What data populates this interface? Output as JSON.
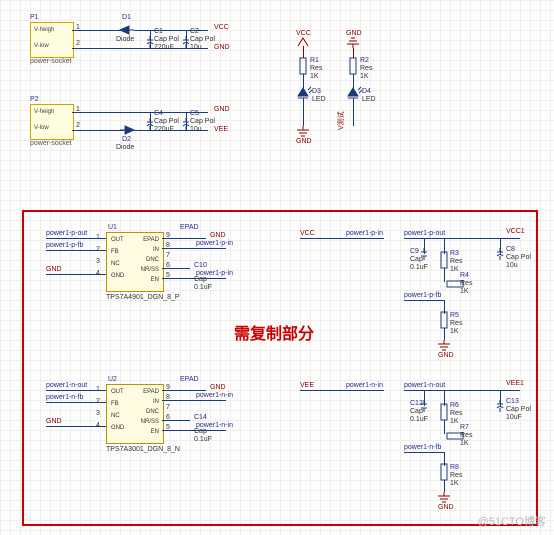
{
  "sockets": {
    "p1": {
      "ref": "P1",
      "type": "power-socket",
      "pin_hi": "V-heigh",
      "pin_lo": "V-low",
      "net_out1": "1",
      "net_out2": "2"
    },
    "p2": {
      "ref": "P2",
      "type": "power-socket",
      "pin_hi": "V-heigh",
      "pin_lo": "V-low",
      "net_out1": "1",
      "net_out2": "2"
    }
  },
  "diodes": {
    "d1": {
      "ref": "D1",
      "type": "Diode"
    },
    "d2": {
      "ref": "D2",
      "type": "Diode"
    },
    "d3": {
      "ref": "D3",
      "type": "LED"
    },
    "d4": {
      "ref": "D4",
      "type": "LED"
    }
  },
  "caps": {
    "c1": {
      "ref": "C1",
      "type": "Cap Pol",
      "val": "220uF"
    },
    "c2": {
      "ref": "C2",
      "type": "Cap Pol",
      "val": "10u"
    },
    "c4": {
      "ref": "C4",
      "type": "Cap Pol",
      "val": "220uF"
    },
    "c5": {
      "ref": "C5",
      "type": "Cap Pol",
      "val": "10u"
    },
    "c8": {
      "ref": "C8",
      "type": "Cap Pol",
      "val": "10u"
    },
    "c9": {
      "ref": "C9",
      "type": "Cap",
      "val": "0.1uF"
    },
    "c10": {
      "ref": "C10",
      "type": "Cap",
      "val": "0.1uF"
    },
    "c12": {
      "ref": "C12",
      "type": "Cap",
      "val": "0.1uF"
    },
    "c13": {
      "ref": "C13",
      "type": "Cap Pol",
      "val": "10uF"
    },
    "c14": {
      "ref": "C14",
      "type": "Cap",
      "val": "0.1uF"
    }
  },
  "res": {
    "r1": {
      "ref": "R1",
      "type": "Res",
      "val": "1K"
    },
    "r2": {
      "ref": "R2",
      "type": "Res",
      "val": "1K"
    },
    "r3": {
      "ref": "R3",
      "type": "Res",
      "val": "1K"
    },
    "r4": {
      "ref": "R4",
      "type": "Res",
      "val": "1K"
    },
    "r5": {
      "ref": "R5",
      "type": "Res",
      "val": "1K"
    },
    "r6": {
      "ref": "R6",
      "type": "Res",
      "val": "1K"
    },
    "r7": {
      "ref": "R7",
      "type": "Res",
      "val": "1K"
    },
    "r8": {
      "ref": "R8",
      "type": "Res",
      "val": "1K"
    }
  },
  "ics": {
    "u1": {
      "ref": "U1",
      "part": "TPS7A4901_DGN_8_P",
      "pins_l": [
        "OUT",
        "FB",
        "NC",
        "GND"
      ],
      "pins_r": [
        "EPAD",
        "IN",
        "DNC",
        "NR/SS",
        "EN"
      ],
      "nums_l": [
        "1",
        "2",
        "3",
        "4"
      ],
      "nums_r": [
        "9",
        "8",
        "7",
        "6",
        "5"
      ],
      "epad": "EPAD"
    },
    "u2": {
      "ref": "U2",
      "part": "TPS7A3001_DGN_8_N",
      "pins_l": [
        "OUT",
        "FB",
        "NC",
        "GND"
      ],
      "pins_r": [
        "EPAD",
        "IN",
        "DNC",
        "NR/SS",
        "EN"
      ],
      "nums_l": [
        "1",
        "2",
        "3",
        "4"
      ],
      "nums_r": [
        "9",
        "8",
        "7",
        "6",
        "5"
      ],
      "epad": "EPAD"
    }
  },
  "rails": {
    "vcc": "VCC",
    "gnd": "GND",
    "vee": "VEE",
    "vcc1": "VCC1",
    "vee1": "VEE1",
    "vtest": "V测试"
  },
  "nets": {
    "p1po": "power1-p-out",
    "p1pf": "power1-p-fb",
    "p1pi": "power1-p-in",
    "p1no": "power1-n-out",
    "p1nf": "power1-n-fb",
    "p1ni": "power1-n-in"
  },
  "annot": {
    "copy": "需复制部分"
  },
  "watermark": "@51CTO博客"
}
